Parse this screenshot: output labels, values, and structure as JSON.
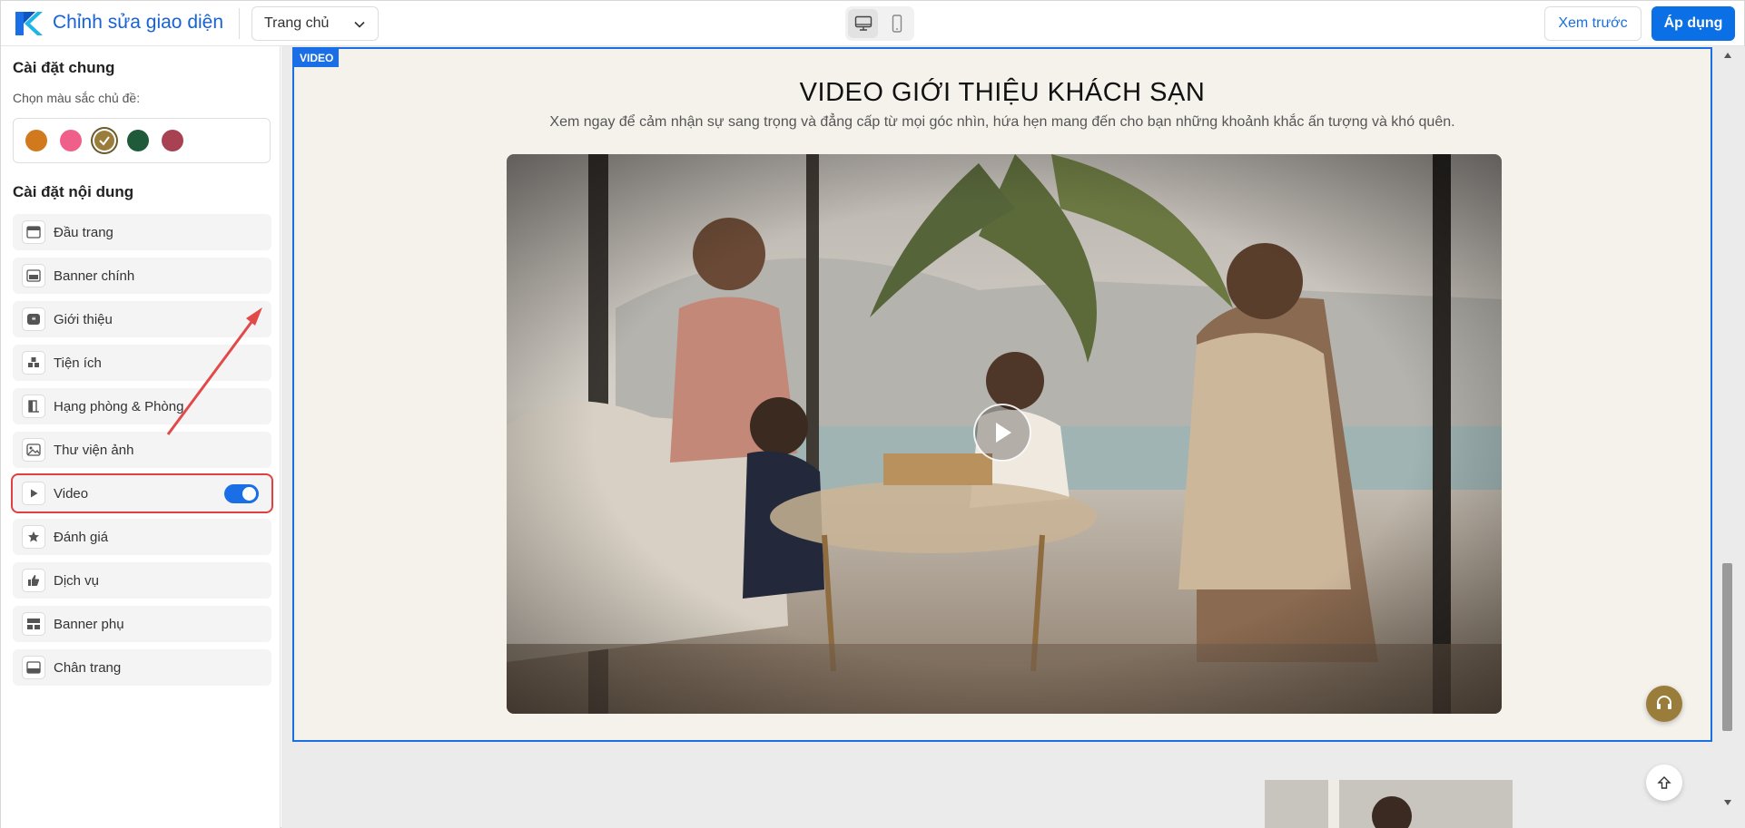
{
  "app": {
    "title": "Chỉnh sửa giao diện",
    "page_selector": "Trang chủ",
    "preview_label": "Xem trước",
    "apply_label": "Áp dụng",
    "brand_color": "#1763d6"
  },
  "sidebar": {
    "general_title": "Cài đặt chung",
    "color_label": "Chọn màu sắc chủ đề:",
    "theme_colors": [
      "#d17a1d",
      "#ef5f8a",
      "#9b7d3b",
      "#1f5a3a",
      "#a84152"
    ],
    "selected_color_index": 2,
    "content_title": "Cài đặt nội dung",
    "items": [
      {
        "label": "Đầu trang",
        "icon": "header-icon"
      },
      {
        "label": "Banner chính",
        "icon": "banner-icon"
      },
      {
        "label": "Giới thiệu",
        "icon": "quote-icon"
      },
      {
        "label": "Tiện ích",
        "icon": "amenities-icon"
      },
      {
        "label": "Hạng phòng & Phòng",
        "icon": "door-icon"
      },
      {
        "label": "Thư viện ảnh",
        "icon": "image-icon"
      },
      {
        "label": "Video",
        "icon": "play-icon",
        "toggle_on": true
      },
      {
        "label": "Đánh giá",
        "icon": "star-icon"
      },
      {
        "label": "Dịch vụ",
        "icon": "thumbs-up-icon"
      },
      {
        "label": "Banner phụ",
        "icon": "sub-banner-icon"
      },
      {
        "label": "Chân trang",
        "icon": "footer-icon"
      }
    ]
  },
  "canvas": {
    "section_tag": "VIDEO",
    "video_title": "VIDEO GIỚI THIỆU KHÁCH SẠN",
    "video_subtitle": "Xem ngay để cảm nhận sự sang trọng và đẳng cấp từ mọi góc nhìn, hứa hẹn mang đến cho bạn những khoảnh khắc ấn tượng và khó quên."
  }
}
